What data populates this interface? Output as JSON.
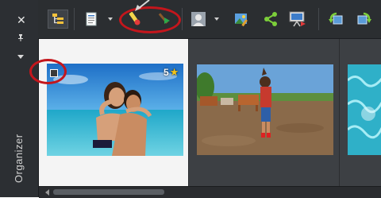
{
  "window": {
    "panel_title": "Organizer"
  },
  "side_panel": {
    "close_icon": "close-icon",
    "pin_icon": "pin-icon",
    "menu_icon": "chevron-down-icon"
  },
  "toolbar": {
    "buttons": [
      {
        "name": "tree-view-icon"
      },
      {
        "name": "document-view-icon"
      },
      {
        "name": "view-dropdown-icon"
      },
      {
        "name": "eraser-icon"
      },
      {
        "name": "wand-icon"
      },
      {
        "name": "person-icon"
      },
      {
        "name": "person-dropdown-icon"
      },
      {
        "name": "image-edit-icon"
      },
      {
        "name": "share-icon"
      },
      {
        "name": "slideshow-icon"
      },
      {
        "name": "rotate-left-icon"
      },
      {
        "name": "rotate-right-icon"
      }
    ]
  },
  "thumbnails": [
    {
      "id": "couple-beach",
      "rating": "5",
      "selected": true
    },
    {
      "id": "boy-cows",
      "rating": "",
      "selected": false
    },
    {
      "id": "pool-water",
      "rating": "",
      "selected": false
    }
  ],
  "colors": {
    "toolbar_bg": "#2b2e31",
    "panel_bg": "#2c2f33",
    "highlight_ring": "#c4161c",
    "star": "#f5c518",
    "selected_tile": "#f4f4f4"
  }
}
